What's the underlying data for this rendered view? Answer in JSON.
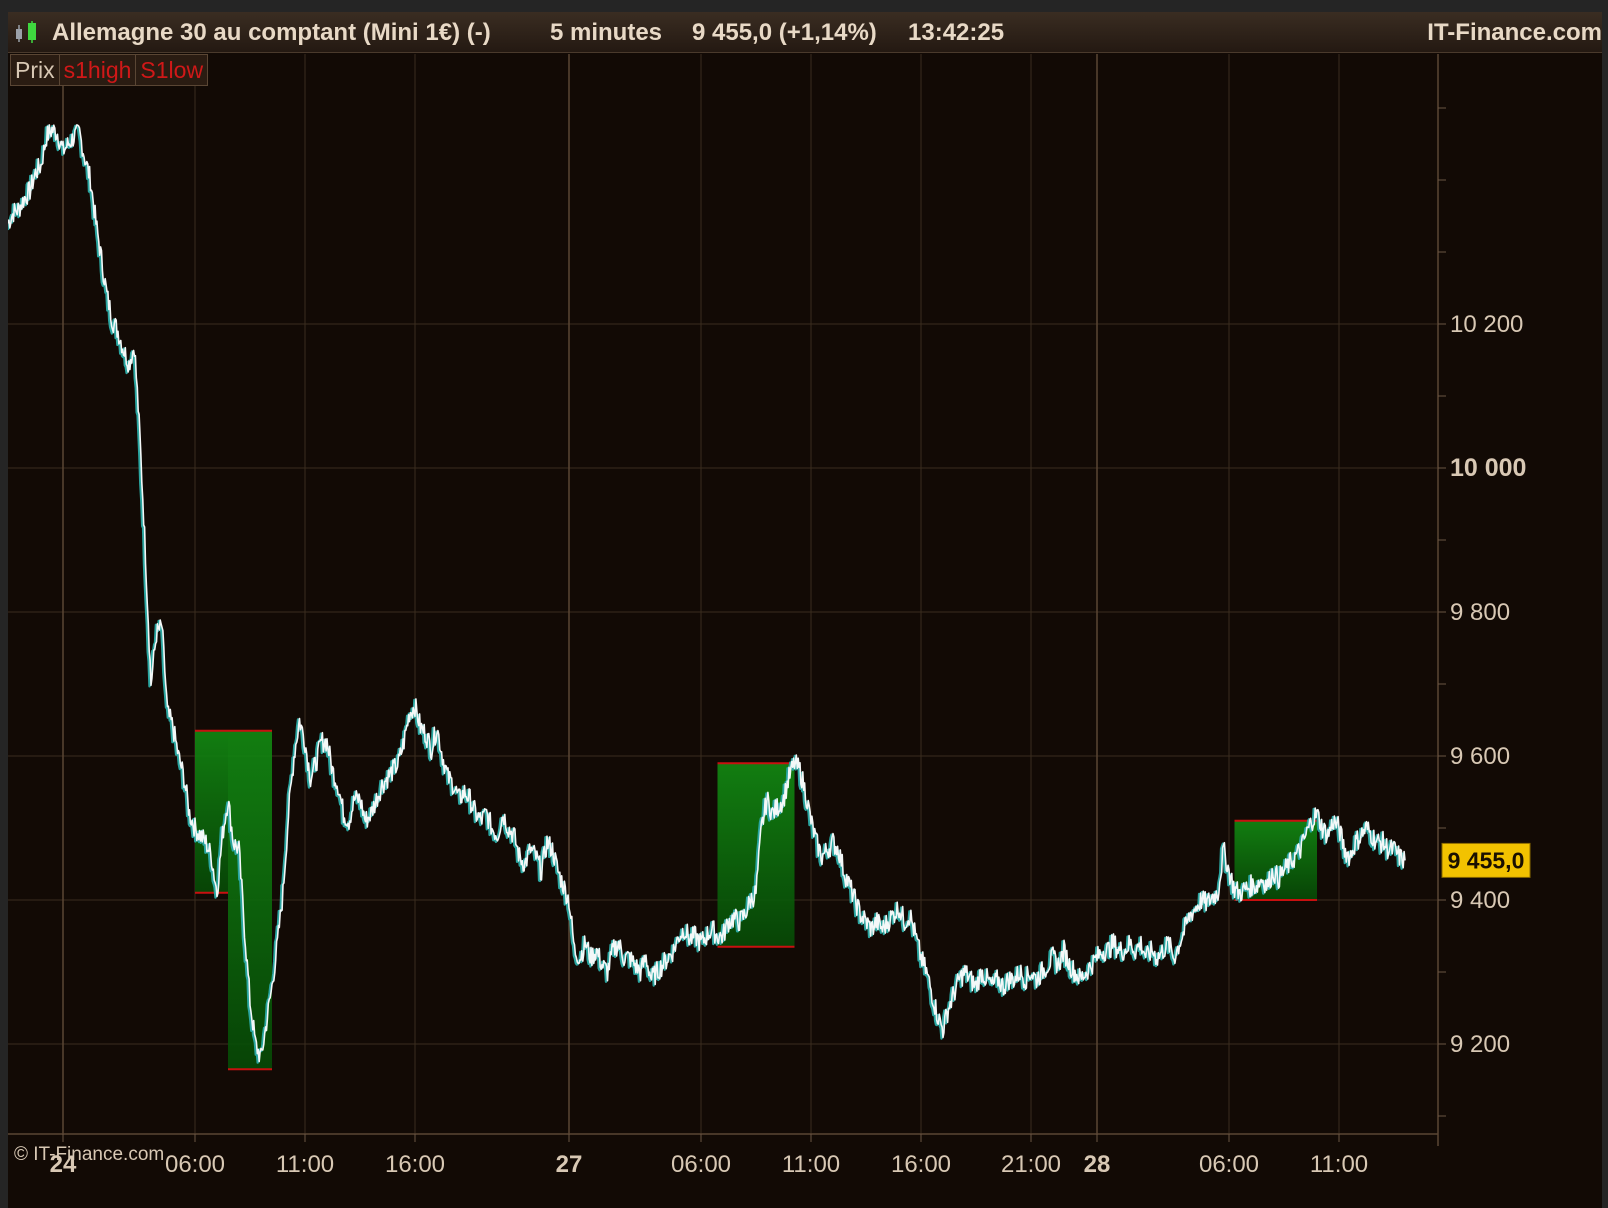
{
  "title_bar": {
    "instrument": "Allemagne 30 au comptant (Mini 1€) (-)",
    "timeframe": "5 minutes",
    "last_price": "9 455,0 (+1,14%)",
    "time": "13:42:25",
    "brand": "IT-Finance.com"
  },
  "legend": {
    "prix": "Prix",
    "high": "s1high",
    "low": "S1low"
  },
  "copyright": "© IT-Finance.com",
  "colors": {
    "background": "#120a05",
    "price_line": "#f4f8f8",
    "price_line_shadow": "#2aa5a0",
    "fill_green": "#0f7a0f",
    "level_red": "#c81010",
    "grid": "#3a2c1f",
    "badge": "#f2c200"
  },
  "chart_data": {
    "type": "line",
    "title": "Allemagne 30 au comptant (Mini 1€) (-)",
    "xlabel": "",
    "ylabel": "",
    "ylim": [
      9075,
      10575
    ],
    "y_ticks": [
      {
        "value": 9200,
        "label": "9 200"
      },
      {
        "value": 9400,
        "label": "9 400"
      },
      {
        "value": 9600,
        "label": "9 600"
      },
      {
        "value": 9800,
        "label": "9 800"
      },
      {
        "value": 10000,
        "label": "10 000"
      },
      {
        "value": 10200,
        "label": "10 200"
      }
    ],
    "x_range": [
      0,
      130
    ],
    "x_ticks": [
      {
        "t": 5,
        "label": "24",
        "major": true
      },
      {
        "t": 17,
        "label": "06:00",
        "major": false
      },
      {
        "t": 27,
        "label": "11:00",
        "major": false
      },
      {
        "t": 37,
        "label": "16:00",
        "major": false
      },
      {
        "t": 51,
        "label": "27",
        "major": true
      },
      {
        "t": 63,
        "label": "06:00",
        "major": false
      },
      {
        "t": 73,
        "label": "11:00",
        "major": false
      },
      {
        "t": 83,
        "label": "16:00",
        "major": false
      },
      {
        "t": 93,
        "label": "21:00",
        "major": false
      },
      {
        "t": 99,
        "label": "28",
        "major": true
      },
      {
        "t": 111,
        "label": "06:00",
        "major": false
      },
      {
        "t": 121,
        "label": "11:00",
        "major": false
      }
    ],
    "current_price": {
      "value": 9455,
      "label": "9 455,0"
    },
    "series": [
      {
        "points": [
          [
            0.0,
            10340
          ],
          [
            0.5,
            10355
          ],
          [
            1.0,
            10360
          ],
          [
            1.5,
            10375
          ],
          [
            2.0,
            10385
          ],
          [
            2.5,
            10410
          ],
          [
            3.0,
            10420
          ],
          [
            3.5,
            10460
          ],
          [
            4.0,
            10470
          ],
          [
            4.5,
            10465
          ],
          [
            5.0,
            10440
          ],
          [
            5.5,
            10450
          ],
          [
            6.0,
            10460
          ],
          [
            6.5,
            10465
          ],
          [
            7.0,
            10430
          ],
          [
            7.5,
            10400
          ],
          [
            8.0,
            10340
          ],
          [
            8.5,
            10290
          ],
          [
            9.0,
            10240
          ],
          [
            9.5,
            10205
          ],
          [
            10.0,
            10190
          ],
          [
            10.5,
            10165
          ],
          [
            11.0,
            10145
          ],
          [
            11.5,
            10170
          ],
          [
            12.0,
            10040
          ],
          [
            12.5,
            9880
          ],
          [
            13.0,
            9700
          ],
          [
            13.5,
            9770
          ],
          [
            14.0,
            9780
          ],
          [
            14.5,
            9660
          ],
          [
            15.0,
            9640
          ],
          [
            15.5,
            9600
          ],
          [
            16.0,
            9570
          ],
          [
            16.5,
            9520
          ],
          [
            17.0,
            9500
          ],
          [
            17.5,
            9490
          ],
          [
            18.0,
            9480
          ],
          [
            18.5,
            9460
          ],
          [
            19.0,
            9410
          ],
          [
            19.5,
            9490
          ],
          [
            20.0,
            9540
          ],
          [
            20.5,
            9480
          ],
          [
            21.0,
            9470
          ],
          [
            21.5,
            9360
          ],
          [
            22.0,
            9260
          ],
          [
            22.5,
            9200
          ],
          [
            23.0,
            9180
          ],
          [
            23.5,
            9230
          ],
          [
            24.0,
            9280
          ],
          [
            24.5,
            9340
          ],
          [
            25.0,
            9410
          ],
          [
            25.5,
            9520
          ],
          [
            26.0,
            9600
          ],
          [
            26.5,
            9650
          ],
          [
            27.0,
            9620
          ],
          [
            27.5,
            9570
          ],
          [
            28.0,
            9590
          ],
          [
            28.5,
            9620
          ],
          [
            29.0,
            9620
          ],
          [
            29.5,
            9580
          ],
          [
            30.0,
            9560
          ],
          [
            30.5,
            9520
          ],
          [
            31.0,
            9510
          ],
          [
            31.5,
            9540
          ],
          [
            32.0,
            9540
          ],
          [
            32.5,
            9510
          ],
          [
            33.0,
            9520
          ],
          [
            33.5,
            9540
          ],
          [
            34.0,
            9560
          ],
          [
            34.5,
            9570
          ],
          [
            35.0,
            9580
          ],
          [
            35.5,
            9590
          ],
          [
            36.0,
            9620
          ],
          [
            36.5,
            9660
          ],
          [
            37.0,
            9670
          ],
          [
            37.5,
            9640
          ],
          [
            38.0,
            9630
          ],
          [
            38.5,
            9610
          ],
          [
            39.0,
            9640
          ],
          [
            39.5,
            9600
          ],
          [
            40.0,
            9570
          ],
          [
            40.5,
            9560
          ],
          [
            41.0,
            9540
          ],
          [
            41.5,
            9550
          ],
          [
            42.0,
            9540
          ],
          [
            42.5,
            9520
          ],
          [
            43.0,
            9510
          ],
          [
            43.5,
            9520
          ],
          [
            44.0,
            9500
          ],
          [
            44.5,
            9490
          ],
          [
            45.0,
            9520
          ],
          [
            45.5,
            9500
          ],
          [
            46.0,
            9490
          ],
          [
            46.5,
            9460
          ],
          [
            47.0,
            9450
          ],
          [
            47.5,
            9470
          ],
          [
            48.0,
            9460
          ],
          [
            48.5,
            9440
          ],
          [
            49.0,
            9480
          ],
          [
            49.5,
            9470
          ],
          [
            50.0,
            9440
          ],
          [
            50.5,
            9420
          ],
          [
            51.0,
            9400
          ],
          [
            51.5,
            9330
          ],
          [
            52.0,
            9320
          ],
          [
            52.5,
            9340
          ],
          [
            53.0,
            9320
          ],
          [
            53.5,
            9330
          ],
          [
            54.0,
            9310
          ],
          [
            54.5,
            9300
          ],
          [
            55.0,
            9330
          ],
          [
            55.5,
            9340
          ],
          [
            56.0,
            9320
          ],
          [
            56.5,
            9320
          ],
          [
            57.0,
            9310
          ],
          [
            57.5,
            9300
          ],
          [
            58.0,
            9320
          ],
          [
            58.5,
            9290
          ],
          [
            59.0,
            9300
          ],
          [
            59.5,
            9310
          ],
          [
            60.0,
            9320
          ],
          [
            60.5,
            9330
          ],
          [
            61.0,
            9350
          ],
          [
            61.5,
            9360
          ],
          [
            62.0,
            9345
          ],
          [
            62.5,
            9350
          ],
          [
            63.0,
            9340
          ],
          [
            63.5,
            9350
          ],
          [
            64.0,
            9360
          ],
          [
            64.5,
            9350
          ],
          [
            65.0,
            9350
          ],
          [
            65.5,
            9370
          ],
          [
            66.0,
            9375
          ],
          [
            66.5,
            9370
          ],
          [
            67.0,
            9380
          ],
          [
            67.5,
            9400
          ],
          [
            68.0,
            9410
          ],
          [
            68.5,
            9500
          ],
          [
            69.0,
            9540
          ],
          [
            69.5,
            9520
          ],
          [
            70.0,
            9530
          ],
          [
            70.5,
            9540
          ],
          [
            71.0,
            9570
          ],
          [
            71.5,
            9590
          ],
          [
            72.0,
            9580
          ],
          [
            72.5,
            9550
          ],
          [
            73.0,
            9510
          ],
          [
            73.5,
            9480
          ],
          [
            74.0,
            9460
          ],
          [
            74.5,
            9470
          ],
          [
            75.0,
            9480
          ],
          [
            75.5,
            9470
          ],
          [
            76.0,
            9440
          ],
          [
            76.5,
            9420
          ],
          [
            77.0,
            9400
          ],
          [
            77.5,
            9380
          ],
          [
            78.0,
            9370
          ],
          [
            78.5,
            9360
          ],
          [
            79.0,
            9370
          ],
          [
            79.5,
            9360
          ],
          [
            80.0,
            9370
          ],
          [
            80.5,
            9380
          ],
          [
            81.0,
            9390
          ],
          [
            81.5,
            9370
          ],
          [
            82.0,
            9380
          ],
          [
            82.5,
            9350
          ],
          [
            83.0,
            9320
          ],
          [
            83.5,
            9300
          ],
          [
            84.0,
            9270
          ],
          [
            84.5,
            9240
          ],
          [
            85.0,
            9220
          ],
          [
            85.5,
            9250
          ],
          [
            86.0,
            9270
          ],
          [
            86.5,
            9290
          ],
          [
            87.0,
            9300
          ],
          [
            87.5,
            9290
          ],
          [
            88.0,
            9280
          ],
          [
            88.5,
            9300
          ],
          [
            89.0,
            9290
          ],
          [
            89.5,
            9280
          ],
          [
            90.0,
            9290
          ],
          [
            90.5,
            9280
          ],
          [
            91.0,
            9290
          ],
          [
            91.5,
            9290
          ],
          [
            92.0,
            9300
          ],
          [
            92.5,
            9290
          ],
          [
            93.0,
            9300
          ],
          [
            93.5,
            9290
          ],
          [
            94.0,
            9300
          ],
          [
            94.5,
            9310
          ],
          [
            95.0,
            9320
          ],
          [
            95.5,
            9310
          ],
          [
            96.0,
            9330
          ],
          [
            96.5,
            9310
          ],
          [
            97.0,
            9300
          ],
          [
            97.5,
            9290
          ],
          [
            98.0,
            9300
          ],
          [
            98.5,
            9310
          ],
          [
            99.0,
            9320
          ],
          [
            99.5,
            9330
          ],
          [
            100.0,
            9330
          ],
          [
            100.5,
            9340
          ],
          [
            101.0,
            9330
          ],
          [
            101.5,
            9330
          ],
          [
            102.0,
            9340
          ],
          [
            102.5,
            9330
          ],
          [
            103.0,
            9340
          ],
          [
            103.5,
            9320
          ],
          [
            104.0,
            9330
          ],
          [
            104.5,
            9320
          ],
          [
            105.0,
            9330
          ],
          [
            105.5,
            9340
          ],
          [
            106.0,
            9320
          ],
          [
            106.5,
            9340
          ],
          [
            107.0,
            9360
          ],
          [
            107.5,
            9380
          ],
          [
            108.0,
            9390
          ],
          [
            108.5,
            9400
          ],
          [
            109.0,
            9395
          ],
          [
            109.5,
            9405
          ],
          [
            110.0,
            9410
          ],
          [
            110.5,
            9470
          ],
          [
            111.0,
            9440
          ],
          [
            111.5,
            9415
          ],
          [
            112.0,
            9410
          ],
          [
            112.5,
            9415
          ],
          [
            113.0,
            9420
          ],
          [
            113.5,
            9420
          ],
          [
            114.0,
            9430
          ],
          [
            114.5,
            9420
          ],
          [
            115.0,
            9440
          ],
          [
            115.5,
            9430
          ],
          [
            116.0,
            9440
          ],
          [
            116.5,
            9450
          ],
          [
            117.0,
            9460
          ],
          [
            117.5,
            9470
          ],
          [
            118.0,
            9490
          ],
          [
            118.5,
            9510
          ],
          [
            119.0,
            9520
          ],
          [
            119.5,
            9500
          ],
          [
            120.0,
            9490
          ],
          [
            120.5,
            9510
          ],
          [
            121.0,
            9500
          ],
          [
            121.5,
            9470
          ],
          [
            122.0,
            9460
          ],
          [
            122.5,
            9480
          ],
          [
            123.0,
            9490
          ],
          [
            123.5,
            9500
          ],
          [
            124.0,
            9490
          ],
          [
            124.5,
            9480
          ],
          [
            125.0,
            9480
          ],
          [
            125.5,
            9470
          ],
          [
            126.0,
            9470
          ],
          [
            126.5,
            9460
          ],
          [
            127.0,
            9455
          ]
        ]
      }
    ],
    "fill_zones": [
      {
        "t0": 17,
        "t1": 20,
        "level_high": 9635,
        "level_low": 9410
      },
      {
        "t0": 20,
        "t1": 24,
        "level_high": 9635,
        "level_low": 9165
      },
      {
        "t0": 64.5,
        "t1": 71.5,
        "level_high": 9590,
        "level_low": 9335
      },
      {
        "t0": 111.5,
        "t1": 119,
        "level_high": 9510,
        "level_low": 9400
      }
    ]
  }
}
